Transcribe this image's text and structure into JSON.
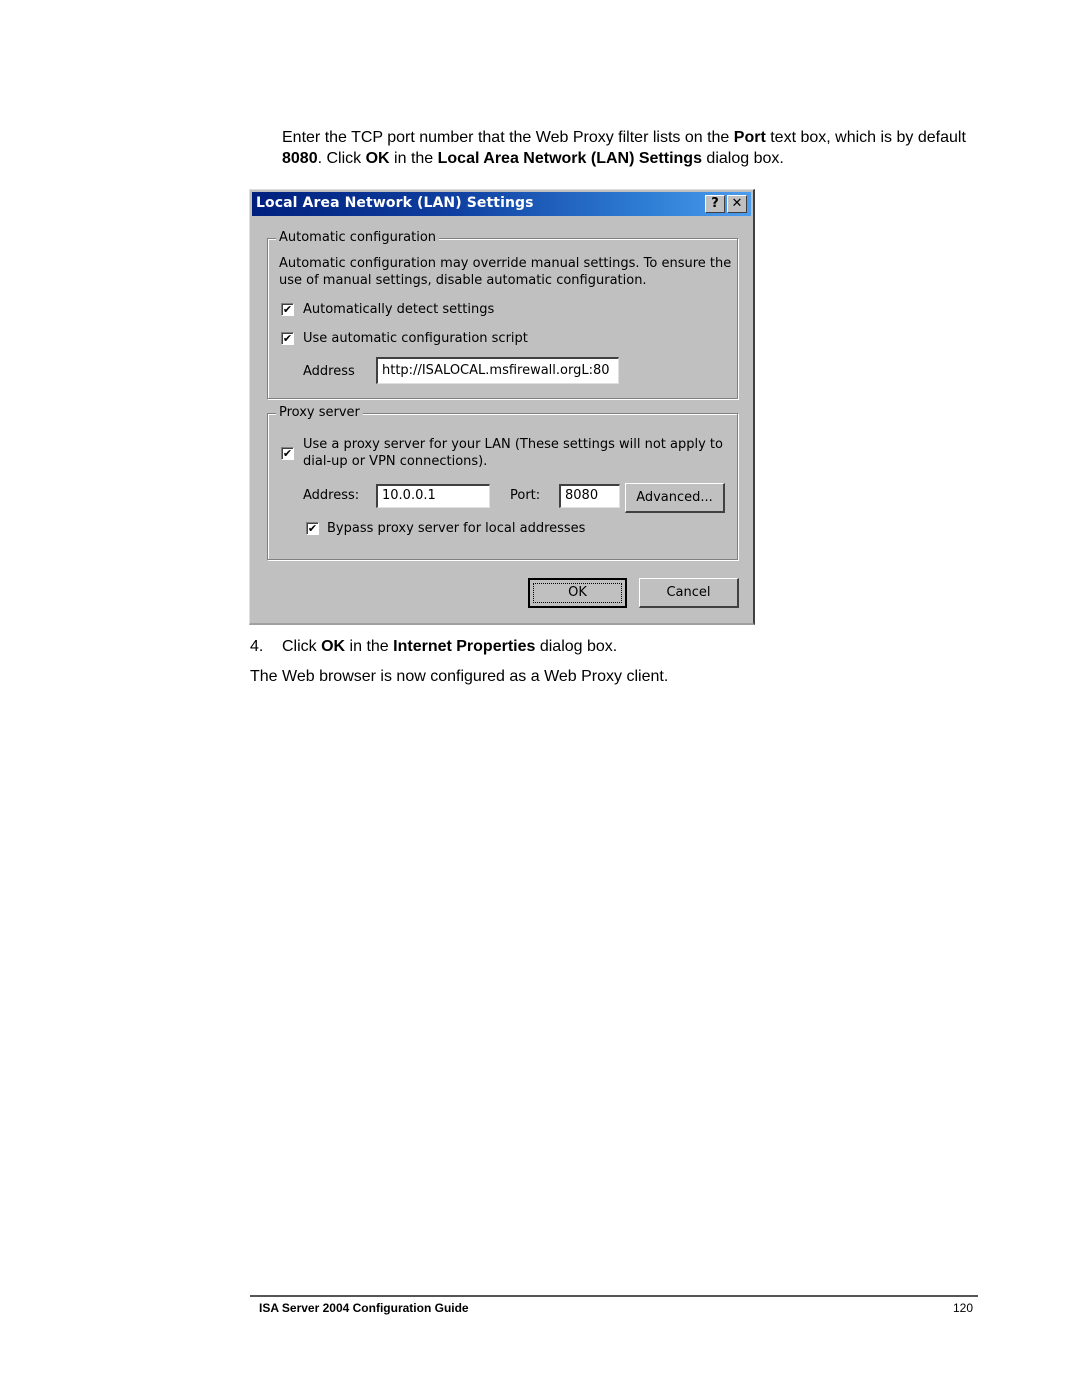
{
  "intro": {
    "parts": [
      {
        "text": "Enter the TCP port number that the Web Proxy filter lists on the ",
        "bold": false
      },
      {
        "text": "Port",
        "bold": true
      },
      {
        "text": " text box, which is by default ",
        "bold": false
      },
      {
        "text": "8080",
        "bold": true
      },
      {
        "text": ". Click ",
        "bold": false
      },
      {
        "text": "OK",
        "bold": true
      },
      {
        "text": " in the ",
        "bold": false
      },
      {
        "text": "Local Area Network (LAN) Settings",
        "bold": true
      },
      {
        "text": " dialog box.",
        "bold": false
      }
    ]
  },
  "dialog": {
    "title": "Local Area Network (LAN) Settings",
    "help_glyph": "?",
    "close_glyph": "✕",
    "auto_config": {
      "group_label": "Automatic configuration",
      "description_line1": "Automatic configuration may override manual settings.  To ensure the",
      "description_line2": "use of manual settings, disable automatic configuration.",
      "detect_settings": {
        "label": "Automatically detect settings",
        "checked": true
      },
      "use_script": {
        "label": "Use automatic configuration script",
        "checked": true
      },
      "address_label": "Address",
      "address_value": "http://ISALOCAL.msfirewall.orgL:80"
    },
    "proxy_server": {
      "group_label": "Proxy server",
      "use_proxy": {
        "label_line1": "Use a proxy server for your LAN (These settings will not apply to",
        "label_line2": "dial-up or VPN connections).",
        "checked": true
      },
      "address_label": "Address:",
      "address_value": "10.0.0.1",
      "port_label": "Port:",
      "port_value": "8080",
      "advanced_button": "Advanced...",
      "bypass_local": {
        "label": "Bypass proxy server for local addresses",
        "checked": true
      }
    },
    "ok_button": "OK",
    "cancel_button": "Cancel",
    "check_glyph": "✔"
  },
  "step4": {
    "number": "4.",
    "parts": [
      {
        "text": "Click ",
        "bold": false
      },
      {
        "text": "OK",
        "bold": true
      },
      {
        "text": " in the ",
        "bold": false
      },
      {
        "text": "Internet Properties",
        "bold": true
      },
      {
        "text": " dialog box.",
        "bold": false
      }
    ]
  },
  "conclusion": "The Web browser is now configured as a Web Proxy client.",
  "footer": {
    "title": "ISA Server 2004 Configuration Guide",
    "page_number": "120"
  }
}
